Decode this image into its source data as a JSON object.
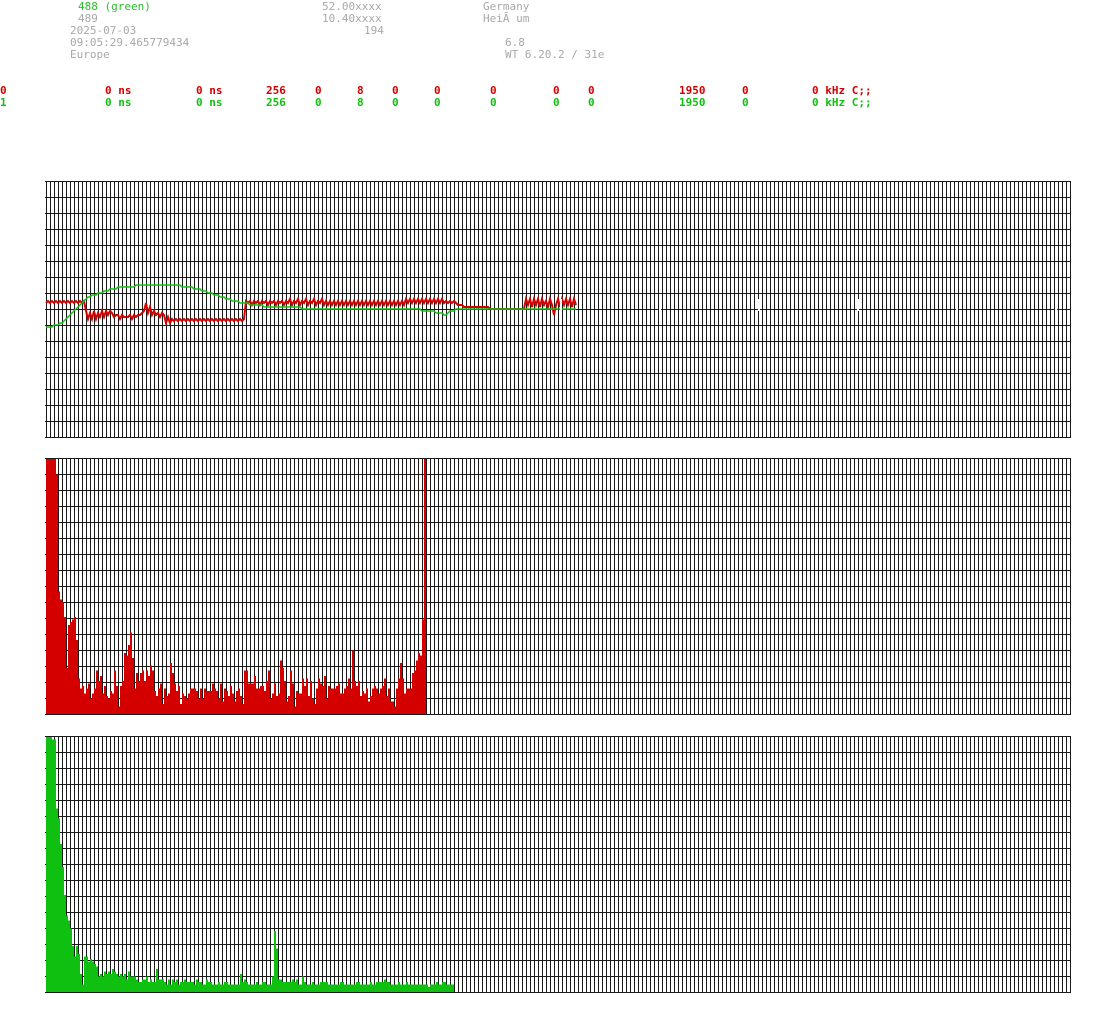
{
  "header": {
    "left": [
      {
        "text": "488 (green)",
        "color": "green"
      },
      {
        "text": "489"
      },
      {
        "text": "2025-07-03"
      },
      {
        "text": "09:05:29.465779434"
      },
      {
        "text": "Europe"
      }
    ],
    "mid_values": [
      "52.00xxxx",
      "10.40xxxx",
      "194"
    ],
    "right_top": [
      "Germany",
      "HeiÃ um"
    ],
    "right_bottom": [
      "6.8",
      "WT 6.20.2 / 31e"
    ]
  },
  "channels": [
    {
      "id": "0",
      "f1": "0 ns",
      "f2": "0 ns",
      "f3": "256",
      "f4": "0",
      "f5": "8",
      "f6": "0",
      "f7": "0",
      "f8": "0",
      "f9": "0",
      "f10": "0",
      "f11": "1950",
      "f12": "0",
      "f13": "0 kHz C;;",
      "color": "#d40000"
    },
    {
      "id": "1",
      "f1": "0 ns",
      "f2": "0 ns",
      "f3": "256",
      "f4": "0",
      "f5": "8",
      "f6": "0",
      "f7": "0",
      "f8": "0",
      "f9": "0",
      "f10": "0",
      "f11": "1950",
      "f12": "0",
      "f13": "0 kHz C;;",
      "color": "#10c010"
    }
  ],
  "colors": {
    "grid": "#1a1a1a",
    "red": "#d40000",
    "green": "#10c010",
    "muted": "#a8a8a8"
  },
  "chart_data": [
    {
      "type": "line",
      "title": "",
      "grid": true,
      "series": [
        {
          "color": "#d40000",
          "values": [
            -2,
            -1,
            -2,
            -1,
            -2,
            -1,
            -2,
            -1,
            -2,
            -1,
            -2,
            -1,
            -2,
            -1,
            -2,
            -1,
            -2,
            -1,
            -2,
            -1,
            -6,
            -10,
            -7,
            -10,
            -6,
            -10,
            -7,
            -9,
            -6,
            -9,
            -6,
            -8,
            -6,
            -7,
            -9,
            -8,
            -8,
            -10,
            -8,
            -9,
            -9,
            -9,
            -8,
            -10,
            -8,
            -9,
            -8,
            -8,
            -7,
            -6,
            -2,
            -7,
            -4,
            -8,
            -6,
            -8,
            -7,
            -9,
            -7,
            -8,
            -12,
            -9,
            -12,
            -10,
            -11,
            -10,
            -11,
            -10,
            -11,
            -10,
            -11,
            -10,
            -11,
            -10,
            -11,
            -10,
            -11,
            -10,
            -11,
            -10,
            -11,
            -10,
            -11,
            -10,
            -11,
            -10,
            -11,
            -10,
            -11,
            -10,
            -11,
            -10,
            -11,
            -10,
            -11,
            -10,
            -11,
            -10,
            -11,
            -10,
            -1,
            -2,
            -1,
            -3,
            -1,
            -2,
            -1,
            -3,
            -1,
            -2,
            -1,
            -3,
            -1,
            -2,
            -1,
            -3,
            -1,
            -2,
            -1,
            -3,
            -1,
            -2,
            0,
            -3,
            -1,
            -2,
            0,
            -3,
            -1,
            -2,
            0,
            -3,
            -1,
            -2,
            0,
            -3,
            -1,
            -2,
            0,
            -3,
            -1,
            -3,
            -1,
            -3,
            -1,
            -3,
            -1,
            -3,
            -1,
            -3,
            -1,
            -3,
            -1,
            -3,
            -1,
            -3,
            -1,
            -3,
            -1,
            -3,
            -1,
            -3,
            -1,
            -3,
            -1,
            -3,
            -1,
            -3,
            -1,
            -3,
            -1,
            -3,
            -1,
            -3,
            -1,
            -3,
            -1,
            -3,
            -1,
            -3,
            0,
            -2,
            0,
            -2,
            0,
            -2,
            0,
            -2,
            0,
            -2,
            0,
            -2,
            0,
            -2,
            0,
            -2,
            0,
            -2,
            0,
            -2,
            -1,
            -2,
            -1,
            -2,
            -1,
            -2,
            -3,
            -3,
            -3,
            -4,
            -4,
            -4,
            -4,
            -4,
            -4,
            -4,
            -4,
            -4,
            -4,
            -4,
            -4,
            -4,
            -5,
            -5,
            -5,
            -5,
            -5,
            -5,
            -5,
            -5,
            -5,
            -5,
            -5,
            -5,
            -5,
            -5,
            -5,
            -5,
            -5,
            -5,
            0,
            -3,
            0,
            -4,
            0,
            -3,
            0,
            -4,
            0,
            -3,
            -1,
            -4,
            0,
            -3,
            -8,
            -3,
            0,
            -4,
            0,
            -3,
            0,
            -3,
            0,
            -4,
            0,
            -3
          ]
        },
        {
          "color": "#10c010",
          "values": [
            -14,
            -14,
            -14,
            -14,
            -13,
            -13,
            -13,
            -12,
            -12,
            -11,
            -10,
            -9,
            -8,
            -7,
            -6,
            -5,
            -4,
            -3,
            -2,
            -1,
            0,
            1,
            1,
            2,
            2,
            2,
            3,
            3,
            3,
            4,
            4,
            4,
            5,
            5,
            5,
            5,
            6,
            6,
            6,
            6,
            6,
            6,
            6,
            6,
            6,
            7,
            7,
            7,
            7,
            7,
            7,
            7,
            7,
            7,
            7,
            7,
            7,
            7,
            7,
            7,
            7,
            7,
            7,
            7,
            7,
            7,
            7,
            7,
            6,
            6,
            6,
            6,
            6,
            6,
            5,
            5,
            5,
            5,
            4,
            4,
            4,
            3,
            3,
            3,
            2,
            2,
            2,
            1,
            1,
            1,
            0,
            0,
            0,
            -1,
            -1,
            -1,
            -1,
            -2,
            -2,
            -2,
            -2,
            -2,
            -3,
            -3,
            -3,
            -3,
            -3,
            -3,
            -3,
            -4,
            -4,
            -4,
            -4,
            -4,
            -4,
            -4,
            -4,
            -4,
            -4,
            -4,
            -4,
            -4,
            -4,
            -4,
            -4,
            -4,
            -4,
            -4,
            -5,
            -5,
            -5,
            -5,
            -5,
            -5,
            -5,
            -5,
            -5,
            -5,
            -5,
            -5,
            -5,
            -5,
            -5,
            -5,
            -5,
            -5,
            -5,
            -5,
            -5,
            -5,
            -5,
            -5,
            -5,
            -5,
            -5,
            -5,
            -5,
            -5,
            -5,
            -5,
            -5,
            -5,
            -5,
            -5,
            -5,
            -5,
            -5,
            -5,
            -5,
            -5,
            -5,
            -5,
            -5,
            -5,
            -5,
            -5,
            -5,
            -5,
            -5,
            -5,
            -5,
            -5,
            -5,
            -5,
            -5,
            -5,
            -5,
            -5,
            -6,
            -6,
            -6,
            -6,
            -6,
            -6,
            -6,
            -7,
            -7,
            -7,
            -7,
            -8,
            -8,
            -7,
            -6,
            -6,
            -6,
            -5,
            -5,
            -5,
            -5,
            -5,
            -5,
            -5,
            -5,
            -5,
            -5,
            -5,
            -5,
            -5,
            -5,
            -5,
            -5,
            -5,
            -5,
            -5,
            -5,
            -5,
            -5,
            -5,
            -5,
            -5,
            -5,
            -5,
            -5,
            -5,
            -5,
            -5,
            -5,
            -5,
            -5,
            -5,
            -5,
            -5,
            -5,
            -5,
            -5,
            -5,
            -5,
            -5,
            -5,
            -5,
            -5,
            -5,
            -5,
            -5,
            -5,
            -5,
            -5,
            -5,
            -5,
            -5,
            -5,
            -5,
            -5,
            -5,
            -5,
            -5
          ]
        }
      ]
    },
    {
      "type": "bar",
      "title": "",
      "grid": true,
      "color": "#d40000",
      "values": [
        100,
        100,
        100,
        100,
        100,
        94,
        48,
        45,
        44,
        38,
        18,
        35,
        36,
        37,
        38,
        29,
        14,
        10,
        11,
        8,
        10,
        12,
        6,
        8,
        10,
        17,
        13,
        15,
        8,
        11,
        7,
        6,
        9,
        8,
        17,
        11,
        3,
        11,
        13,
        24,
        23,
        27,
        32,
        22,
        10,
        16,
        13,
        16,
        17,
        13,
        17,
        15,
        19,
        17,
        9,
        7,
        10,
        12,
        4,
        10,
        7,
        8,
        20,
        16,
        12,
        9,
        11,
        4,
        8,
        7,
        6,
        8,
        10,
        10,
        10,
        9,
        6,
        10,
        6,
        10,
        9,
        9,
        9,
        12,
        10,
        9,
        6,
        12,
        5,
        10,
        9,
        7,
        11,
        8,
        5,
        9,
        10,
        7,
        4,
        17,
        17,
        12,
        12,
        12,
        15,
        10,
        10,
        11,
        11,
        9,
        13,
        17,
        6,
        8,
        12,
        7,
        8,
        21,
        18,
        13,
        5,
        7,
        17,
        12,
        3,
        9,
        8,
        8,
        14,
        11,
        14,
        7,
        13,
        6,
        4,
        10,
        14,
        12,
        11,
        15,
        6,
        11,
        10,
        10,
        10,
        11,
        12,
        8,
        8,
        10,
        11,
        14,
        10,
        25,
        13,
        11,
        13,
        7,
        9,
        8,
        10,
        5,
        7,
        10,
        11,
        10,
        8,
        10,
        11,
        14,
        7,
        10,
        5,
        5,
        3,
        10,
        14,
        20,
        14,
        8,
        10,
        10,
        10,
        16,
        17,
        21,
        24,
        23,
        37,
        100
      ]
    },
    {
      "type": "bar",
      "title": "",
      "grid": true,
      "color": "#10c010",
      "values": [
        100,
        100,
        100,
        99,
        99,
        72,
        68,
        58,
        49,
        38,
        30,
        28,
        25,
        18,
        14,
        18,
        15,
        7,
        3,
        14,
        14,
        12,
        13,
        12,
        11,
        10,
        6,
        7,
        6,
        8,
        7,
        8,
        7,
        9,
        8,
        7,
        6,
        7,
        6,
        7,
        5,
        8,
        6,
        6,
        6,
        5,
        4,
        4,
        5,
        5,
        6,
        4,
        5,
        4,
        4,
        9,
        5,
        5,
        5,
        4,
        3,
        5,
        3,
        5,
        4,
        5,
        3,
        4,
        4,
        5,
        4,
        4,
        4,
        4,
        3,
        5,
        4,
        4,
        3,
        3,
        5,
        4,
        4,
        3,
        3,
        3,
        4,
        3,
        3,
        4,
        4,
        3,
        3,
        3,
        3,
        3,
        3,
        7,
        4,
        5,
        4,
        3,
        3,
        3,
        3,
        4,
        3,
        3,
        4,
        4,
        3,
        3,
        3,
        6,
        24,
        17,
        5,
        5,
        4,
        4,
        4,
        4,
        4,
        5,
        4,
        5,
        3,
        3,
        6,
        4,
        3,
        3,
        3,
        4,
        3,
        3,
        3,
        4,
        4,
        4,
        4,
        3,
        3,
        3,
        3,
        3,
        3,
        4,
        4,
        3,
        3,
        3,
        3,
        3,
        3,
        4,
        4,
        3,
        3,
        3,
        3,
        3,
        4,
        3,
        3,
        4,
        4,
        4,
        4,
        5,
        4,
        4,
        3,
        3,
        3,
        3,
        4,
        3,
        3,
        3,
        4,
        3,
        3,
        3,
        3,
        3,
        3,
        3,
        3,
        3,
        3,
        2,
        3,
        3,
        3,
        4,
        3,
        3,
        4,
        4,
        3,
        3,
        3,
        3
      ]
    }
  ]
}
